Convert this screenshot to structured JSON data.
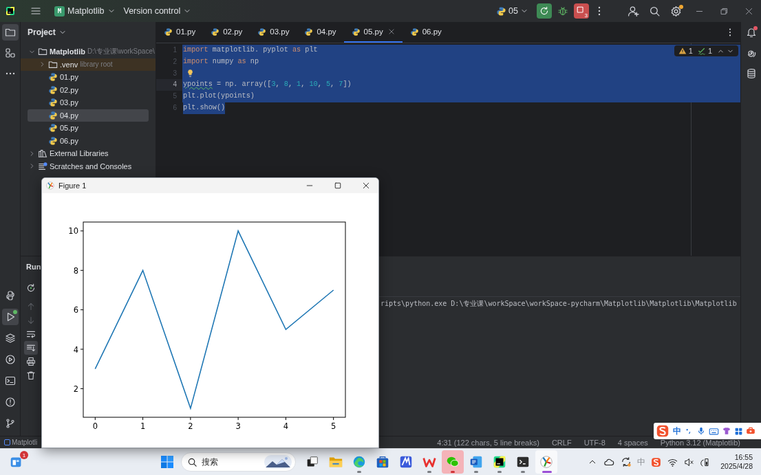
{
  "title_bar": {
    "project_badge": "M",
    "project": "Matplotlib",
    "vcs": "Version control",
    "run_config": "05",
    "stop_count": "3",
    "settings_update": true
  },
  "left_stripe": {
    "top": [
      {
        "kind": "folder",
        "selected": true,
        "running": false
      },
      {
        "kind": "structure",
        "selected": false,
        "running": false
      },
      {
        "kind": "more",
        "selected": false,
        "running": false
      }
    ],
    "bottom": [
      {
        "kind": "python",
        "selected": false,
        "running": false
      },
      {
        "kind": "run",
        "selected": true,
        "running": true
      },
      {
        "kind": "layers",
        "selected": false,
        "running": false
      },
      {
        "kind": "services",
        "selected": false,
        "running": false
      },
      {
        "kind": "terminal",
        "selected": false,
        "running": false
      },
      {
        "kind": "problems",
        "selected": false,
        "running": false
      },
      {
        "kind": "git",
        "selected": false,
        "running": false
      }
    ]
  },
  "right_stripe": [
    {
      "kind": "bell",
      "badge": true
    },
    {
      "kind": "spiral",
      "badge": false
    },
    {
      "kind": "database",
      "badge": false
    }
  ],
  "project_panel": {
    "title": "Project",
    "tree": [
      {
        "label": "Matplotlib",
        "hint": "D:\\专业课\\workSpace\\",
        "kind": "folder",
        "expanded": true,
        "selected": false,
        "highlighted": false,
        "children": [
          {
            "label": ".venv",
            "hint": "library root",
            "kind": "folder",
            "expanded": false,
            "selected": false,
            "highlighted": true
          },
          {
            "label": "01.py",
            "kind": "python",
            "selected": false,
            "highlighted": false
          },
          {
            "label": "02.py",
            "kind": "python",
            "selected": false,
            "highlighted": false
          },
          {
            "label": "03.py",
            "kind": "python",
            "selected": false,
            "highlighted": false
          },
          {
            "label": "04.py",
            "kind": "python",
            "selected": true,
            "highlighted": false
          },
          {
            "label": "05.py",
            "kind": "python",
            "selected": false,
            "highlighted": false
          },
          {
            "label": "06.py",
            "kind": "python",
            "selected": false,
            "highlighted": false
          }
        ]
      },
      {
        "label": "External Libraries",
        "kind": "library",
        "expanded": false,
        "selected": false,
        "highlighted": false
      },
      {
        "label": "Scratches and Consoles",
        "kind": "scratch",
        "expanded": false,
        "selected": false,
        "highlighted": false
      }
    ]
  },
  "editor": {
    "tabs": [
      {
        "label": "01.py",
        "selected": false
      },
      {
        "label": "02.py",
        "selected": false
      },
      {
        "label": "03.py",
        "selected": false
      },
      {
        "label": "04.py",
        "selected": false
      },
      {
        "label": "05.py",
        "selected": true
      },
      {
        "label": "06.py",
        "selected": false
      }
    ],
    "inspections": {
      "warnings": "1",
      "typos": "1"
    },
    "lines": [
      {
        "number": "1",
        "current": false,
        "selected": true,
        "whole_line": true,
        "tokens": [
          {
            "kind": "kw",
            "text": "import"
          },
          {
            "kind": "plain",
            "text": " matplotlib. pyplot "
          },
          {
            "kind": "kw",
            "text": "as"
          },
          {
            "kind": "plain",
            "text": " plt"
          }
        ]
      },
      {
        "number": "2",
        "current": false,
        "selected": true,
        "whole_line": true,
        "tokens": [
          {
            "kind": "kw",
            "text": "import"
          },
          {
            "kind": "plain",
            "text": " numpy "
          },
          {
            "kind": "kw",
            "text": "as"
          },
          {
            "kind": "plain",
            "text": " np"
          }
        ]
      },
      {
        "number": "3",
        "current": false,
        "selected": true,
        "whole_line": true,
        "bulb": true
      },
      {
        "number": "4",
        "current": true,
        "selected": true,
        "whole_line": true,
        "tokens": [
          {
            "kind": "typo",
            "text": "ypoints"
          },
          {
            "kind": "plain",
            "text": " = np. array(["
          },
          {
            "kind": "num",
            "text": "3"
          },
          {
            "kind": "plain",
            "text": ", "
          },
          {
            "kind": "num",
            "text": "8"
          },
          {
            "kind": "plain",
            "text": ", "
          },
          {
            "kind": "num",
            "text": "1"
          },
          {
            "kind": "plain",
            "text": ", "
          },
          {
            "kind": "num",
            "text": "10"
          },
          {
            "kind": "plain",
            "text": ", "
          },
          {
            "kind": "num",
            "text": "5"
          },
          {
            "kind": "plain",
            "text": ", "
          },
          {
            "kind": "num",
            "text": "7"
          },
          {
            "kind": "plain",
            "text": "])"
          }
        ]
      },
      {
        "number": "5",
        "current": false,
        "selected": true,
        "whole_line": true,
        "tokens": [
          {
            "kind": "plain",
            "text": "plt.plot(ypoints)"
          }
        ]
      },
      {
        "number": "6",
        "current": false,
        "selected": true,
        "whole_line": false,
        "tokens": [
          {
            "kind": "plain",
            "text": "plt.show()"
          }
        ]
      }
    ]
  },
  "run_panel": {
    "title": "Run",
    "tools": [
      {
        "kind": "rerun",
        "disabled": false,
        "selected": false
      },
      {
        "kind": "up",
        "disabled": true,
        "selected": false
      },
      {
        "kind": "down",
        "disabled": true,
        "selected": false
      },
      {
        "kind": "wrap",
        "disabled": false,
        "selected": false
      },
      {
        "kind": "scrollend",
        "disabled": false,
        "selected": true
      },
      {
        "kind": "print",
        "disabled": false,
        "selected": false
      },
      {
        "kind": "trash",
        "disabled": false,
        "selected": false
      }
    ],
    "console": [
      "ripts\\python.exe D:\\专业课\\workSpace\\workSpace-pycharm\\Matplotlib\\Matplotlib\\Matplotlib"
    ]
  },
  "status_bar": {
    "project": "Matplotli",
    "items": [
      "4:31 (122 chars, 5 line breaks)",
      "CRLF",
      "UTF-8",
      "4 spaces",
      "Python 3.12 (Matplotlib)"
    ]
  },
  "ime_bar": {
    "mode": "中"
  },
  "figure_window": {
    "title": "Figure 1",
    "chart_data": {
      "type": "line",
      "x": [
        0,
        1,
        2,
        3,
        4,
        5
      ],
      "series": [
        {
          "color": "#1f77b4",
          "values": [
            3,
            8,
            1,
            10,
            5,
            7
          ]
        }
      ],
      "xlim": [
        -0.25,
        5.25
      ],
      "ylim": [
        0.55,
        10.45
      ],
      "xticks": [
        0,
        1,
        2,
        3,
        4,
        5
      ],
      "yticks": [
        2,
        4,
        6,
        8,
        10
      ]
    }
  },
  "taskbar": {
    "widget_badge": "1",
    "search_placeholder": "搜索",
    "apps": [
      {
        "kind": "taskview",
        "running": false,
        "attention": false,
        "active": false
      },
      {
        "kind": "explorer",
        "running": false,
        "attention": false,
        "active": false
      },
      {
        "kind": "edge",
        "running": true,
        "attention": false,
        "active": false
      },
      {
        "kind": "store",
        "running": false,
        "attention": false,
        "active": false
      },
      {
        "kind": "mapp",
        "running": false,
        "attention": false,
        "active": false
      },
      {
        "kind": "wps",
        "running": true,
        "attention": false,
        "active": false
      },
      {
        "kind": "wechat",
        "running": true,
        "attention": true,
        "active": false
      },
      {
        "kind": "word",
        "running": true,
        "attention": false,
        "active": false
      },
      {
        "kind": "pycharm",
        "running": true,
        "attention": false,
        "active": false
      },
      {
        "kind": "terminal",
        "running": true,
        "attention": false,
        "active": false
      },
      {
        "kind": "figure",
        "running": true,
        "attention": false,
        "active": true
      }
    ],
    "tray_ime": "中",
    "time": "16:55",
    "date": "2025/4/28"
  }
}
